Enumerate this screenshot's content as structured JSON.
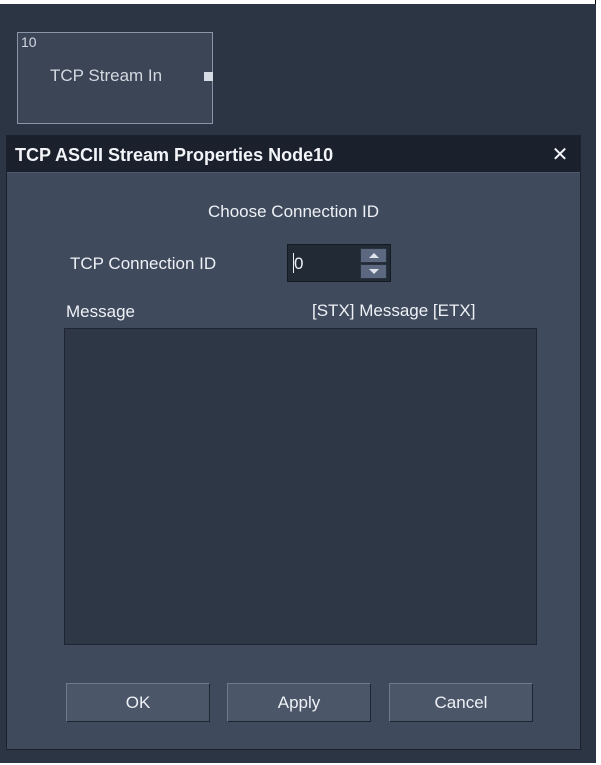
{
  "node": {
    "id": "10",
    "title": "TCP Stream In"
  },
  "dialog": {
    "title": "TCP ASCII Stream Properties Node10",
    "close_glyph": "✕",
    "heading": "Choose Connection ID",
    "connection": {
      "label": "TCP Connection ID",
      "value": "0"
    },
    "message": {
      "label": "Message",
      "format": "[STX] Message [ETX]",
      "value": ""
    },
    "buttons": {
      "ok": "OK",
      "apply": "Apply",
      "cancel": "Cancel"
    }
  },
  "icons": {
    "close": "close-icon",
    "spin_up": "chevron-up-icon",
    "spin_down": "chevron-down-icon",
    "node_port": "output-port-icon"
  },
  "colors": {
    "background": "#2c3543",
    "dialog": "#3f4a5c",
    "titlebar": "#1a212d",
    "text": "#eef1f6"
  }
}
